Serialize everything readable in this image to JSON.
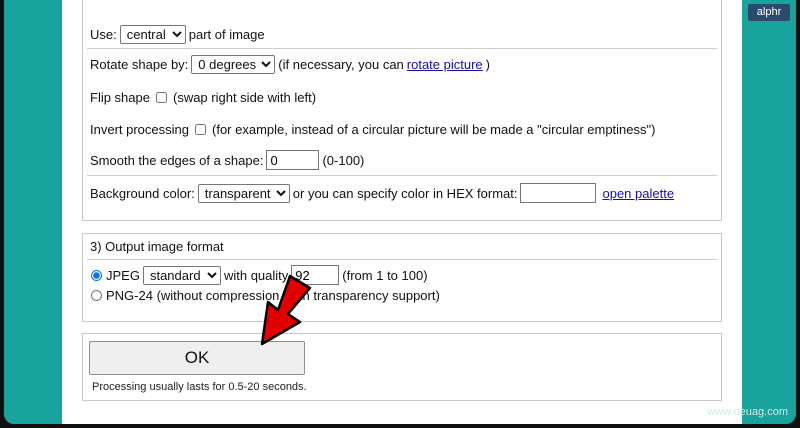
{
  "brand": {
    "logo_text": "alphr",
    "watermark": "www.deuag.com"
  },
  "settings": {
    "use": {
      "prefix": "Use:",
      "selected": "central",
      "suffix": "part of image"
    },
    "rotate": {
      "label": "Rotate shape by:",
      "selected": "0 degrees (",
      "note_prefix": "(if necessary, you can",
      "link": "rotate picture",
      "note_suffix": ")"
    },
    "flip": {
      "label": "Flip shape",
      "note": "(swap right side with left)"
    },
    "invert": {
      "label": "Invert processing",
      "note": "(for example, instead of a circular picture will be made a \"circular emptiness\")"
    },
    "smooth": {
      "label": "Smooth the edges of a shape:",
      "value": "0",
      "range": "(0-100)"
    },
    "background": {
      "label": "Background color:",
      "selected": "transparent (",
      "middle": "or you can specify color in HEX format:",
      "hex_value": "",
      "link": "open palette"
    }
  },
  "output": {
    "title": "3) Output image format",
    "jpeg": {
      "label": "JPEG",
      "selected": "standard",
      "quality_label": "with quality",
      "quality": "92",
      "range": "(from 1 to 100)"
    },
    "png": {
      "label": "PNG-24 (without compression, with transparency support)"
    }
  },
  "submit": {
    "ok_label": "OK",
    "note": "Processing usually lasts for 0.5-20 seconds."
  },
  "colors": {
    "frame": "#18a49c",
    "link": "#1a0dab",
    "arrow": "#e00000"
  }
}
